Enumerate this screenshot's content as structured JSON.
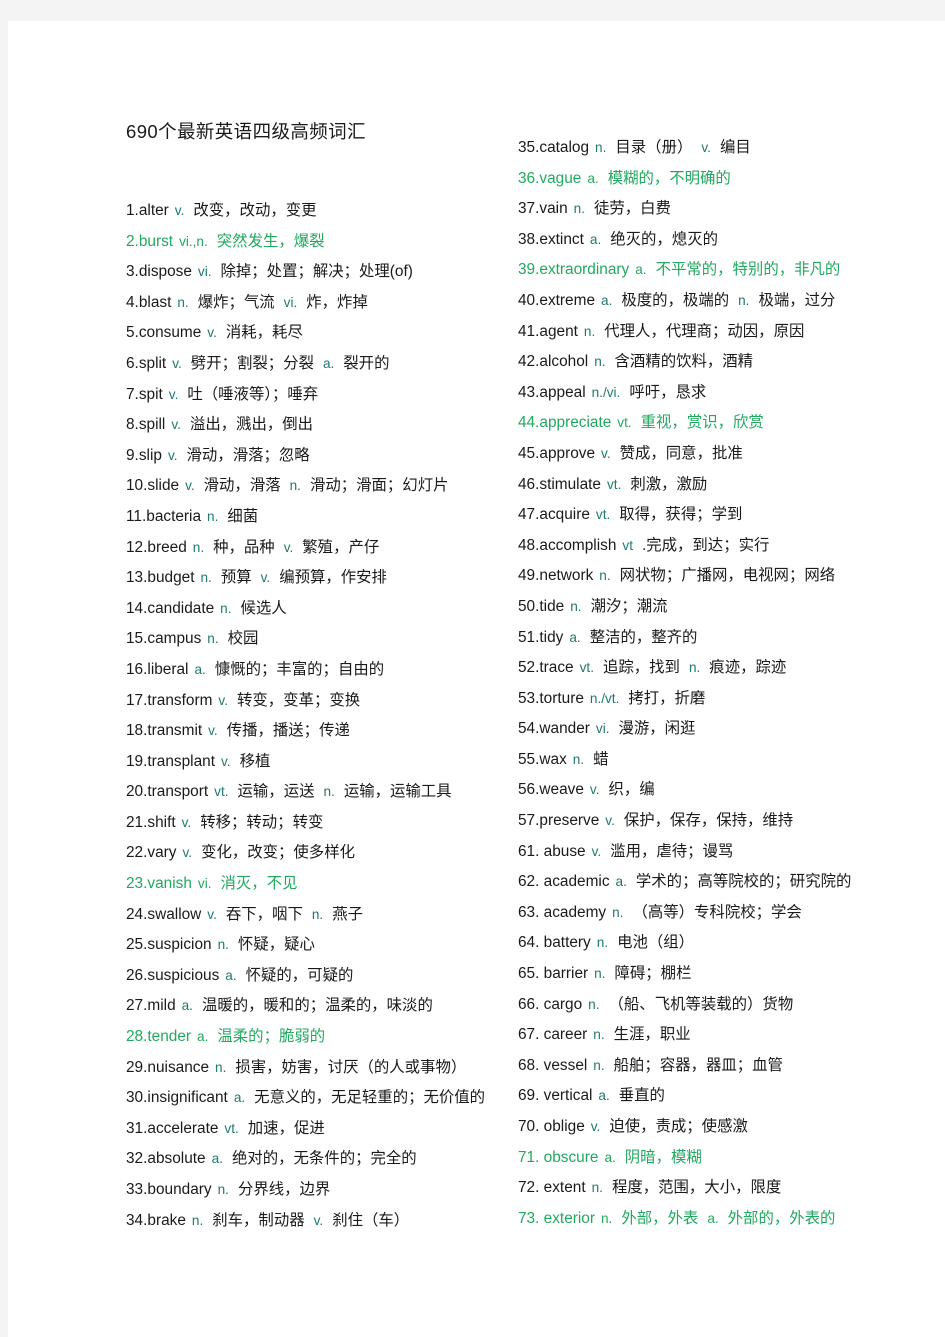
{
  "document": {
    "title": "690个最新英语四级高频词汇",
    "colors": {
      "body_text": "#1a1a1a",
      "highlight_green": "#22a95f",
      "part_of_speech_teal": "#1f7a6e",
      "page_background": "#ffffff",
      "canvas_background": "#f4f4f4"
    }
  },
  "left_column": [
    {
      "num": "1.",
      "word": "alter",
      "pos": "v.",
      "gloss": "改变，改动，变更",
      "green": false
    },
    {
      "num": "2.",
      "word": "burst",
      "pos": "vi.,n.",
      "gloss": "突然发生，爆裂",
      "green": true
    },
    {
      "num": "3.",
      "word": "dispose",
      "pos": "vi.",
      "gloss": "除掉；处置；解决；处理(of)",
      "green": false
    },
    {
      "num": "4.",
      "word": "blast",
      "pos": "n.",
      "gloss": "爆炸；气流",
      "pos2": "vi.",
      "gloss2": "炸，炸掉",
      "green": false
    },
    {
      "num": "5.",
      "word": "consume",
      "pos": "v.",
      "gloss": "消耗，耗尽",
      "green": false
    },
    {
      "num": "6.",
      "word": "split",
      "pos": "v.",
      "gloss": "劈开；割裂；分裂",
      "pos2": "a.",
      "gloss2": "裂开的",
      "green": false
    },
    {
      "num": "7.",
      "word": "spit",
      "pos": "v.",
      "gloss": "吐（唾液等）；唾弃",
      "green": false
    },
    {
      "num": "8.",
      "word": "spill",
      "pos": "v.",
      "gloss": "溢出，溅出，倒出",
      "green": false
    },
    {
      "num": "9.",
      "word": "slip",
      "pos": "v.",
      "gloss": "滑动，滑落；忽略",
      "green": false
    },
    {
      "num": "10.",
      "word": "slide",
      "pos": "v.",
      "gloss": "滑动，滑落",
      "pos2": "n.",
      "gloss2": "滑动；滑面；幻灯片",
      "green": false
    },
    {
      "num": "11.",
      "word": "bacteria",
      "pos": "n.",
      "gloss": "细菌",
      "green": false
    },
    {
      "num": "12.",
      "word": "breed",
      "pos": "n.",
      "gloss": "种，品种",
      "pos2": "v.",
      "gloss2": "繁殖，产仔",
      "green": false
    },
    {
      "num": "13.",
      "word": "budget",
      "pos": "n.",
      "gloss": "预算",
      "pos2": "v.",
      "gloss2": "编预算，作安排",
      "green": false
    },
    {
      "num": "14.",
      "word": "candidate",
      "pos": "n.",
      "gloss": "候选人",
      "green": false
    },
    {
      "num": "15.",
      "word": "campus",
      "pos": "n.",
      "gloss": "校园",
      "green": false
    },
    {
      "num": "16.",
      "word": "liberal",
      "pos": "a.",
      "gloss": "慷慨的；丰富的；自由的",
      "green": false
    },
    {
      "num": "17.",
      "word": "transform",
      "pos": "v.",
      "gloss": "转变，变革；变换",
      "green": false
    },
    {
      "num": "18.",
      "word": "transmit",
      "pos": "v.",
      "gloss": "传播，播送；传递",
      "green": false
    },
    {
      "num": "19.",
      "word": "transplant",
      "pos": "v.",
      "gloss": "移植",
      "green": false
    },
    {
      "num": "20.",
      "word": "transport",
      "pos": "vt.",
      "gloss": "运输，运送",
      "pos2": "n.",
      "gloss2": "运输，运输工具",
      "green": false
    },
    {
      "num": "21.",
      "word": "shift",
      "pos": "v.",
      "gloss": "转移；转动；转变",
      "green": false
    },
    {
      "num": "22.",
      "word": "vary",
      "pos": "v.",
      "gloss": "变化，改变；使多样化",
      "green": false
    },
    {
      "num": "23.",
      "word": "vanish",
      "pos": "vi.",
      "gloss": "消灭，不见",
      "green": true
    },
    {
      "num": "24.",
      "word": "swallow",
      "pos": "v.",
      "gloss": "吞下，咽下",
      "pos2": "n.",
      "gloss2": "燕子",
      "green": false
    },
    {
      "num": "25.",
      "word": "suspicion",
      "pos": "n.",
      "gloss": "怀疑，疑心",
      "green": false
    },
    {
      "num": "26.",
      "word": "suspicious",
      "pos": "a.",
      "gloss": "怀疑的，可疑的",
      "green": false
    },
    {
      "num": "27.",
      "word": "mild",
      "pos": "a.",
      "gloss": "温暖的，暖和的；温柔的，味淡的",
      "green": false
    },
    {
      "num": "28.",
      "word": "tender",
      "pos": "a.",
      "gloss": "温柔的；脆弱的",
      "green": true
    },
    {
      "num": "29.",
      "word": "nuisance",
      "pos": "n.",
      "gloss": "损害，妨害，讨厌（的人或事物）",
      "green": false
    },
    {
      "num": "30.",
      "word": "insignificant",
      "pos": "a.",
      "gloss": "无意义的，无足轻重的；无价值的",
      "green": false
    },
    {
      "num": "31.",
      "word": "accelerate",
      "pos": "vt.",
      "gloss": "加速，促进",
      "green": false
    },
    {
      "num": "32.",
      "word": "absolute",
      "pos": "a.",
      "gloss": "绝对的，无条件的；完全的",
      "green": false
    },
    {
      "num": "33.",
      "word": "boundary",
      "pos": "n.",
      "gloss": "分界线，边界",
      "green": false
    },
    {
      "num": "34.",
      "word": "brake",
      "pos": "n.",
      "gloss": "刹车，制动器",
      "pos2": "v.",
      "gloss2": "刹住（车）",
      "green": false
    }
  ],
  "right_column": [
    {
      "num": "35.",
      "word": "catalog",
      "pos": "n.",
      "gloss": "目录（册）",
      "pos2": "v.",
      "gloss2": "编目",
      "green": false
    },
    {
      "num": "36.",
      "word": "vague",
      "pos": "a.",
      "gloss": "模糊的，不明确的",
      "green": true
    },
    {
      "num": "37.",
      "word": "vain",
      "pos": "n.",
      "gloss": "徒劳，白费",
      "green": false
    },
    {
      "num": "38.",
      "word": "extinct",
      "pos": "a.",
      "gloss": "绝灭的，熄灭的",
      "green": false
    },
    {
      "num": "39.",
      "word": "extraordinary",
      "pos": "a.",
      "gloss": "不平常的，特别的，非凡的",
      "green": true
    },
    {
      "num": "40.",
      "word": "extreme",
      "pos": "a.",
      "gloss": "极度的，极端的",
      "pos2": "n.",
      "gloss2": "极端，过分",
      "green": false
    },
    {
      "num": "41.",
      "word": "agent",
      "pos": "n.",
      "gloss": "代理人，代理商；动因，原因",
      "green": false
    },
    {
      "num": "42.",
      "word": "alcohol",
      "pos": "n.",
      "gloss": "含酒精的饮料，酒精",
      "green": false
    },
    {
      "num": "43.",
      "word": "appeal",
      "pos": "n./vi.",
      "gloss": "呼吁，恳求",
      "green": false
    },
    {
      "num": "44.",
      "word": "appreciate",
      "pos": "vt.",
      "gloss": "重视，赏识，欣赏",
      "green": true
    },
    {
      "num": "45.",
      "word": "approve",
      "pos": "v.",
      "gloss": "赞成，同意，批准",
      "green": false
    },
    {
      "num": "46.",
      "word": "stimulate",
      "pos": "vt.",
      "gloss": "刺激，激励",
      "green": false
    },
    {
      "num": "47.",
      "word": "acquire",
      "pos": "vt.",
      "gloss": "取得，获得；学到",
      "green": false
    },
    {
      "num": "48.",
      "word": "accomplish",
      "pos": "vt",
      "gloss": ".完成，到达；实行",
      "green": false
    },
    {
      "num": "49.",
      "word": "network",
      "pos": "n.",
      "gloss": "网状物；广播网，电视网；网络",
      "green": false
    },
    {
      "num": "50.",
      "word": "tide",
      "pos": "n.",
      "gloss": "潮汐；潮流",
      "green": false
    },
    {
      "num": "51.",
      "word": "tidy",
      "pos": "a.",
      "gloss": "整洁的，整齐的",
      "green": false
    },
    {
      "num": "52.",
      "word": "trace",
      "pos": "vt.",
      "gloss": "追踪，找到",
      "pos2": "n.",
      "gloss2": "痕迹，踪迹",
      "green": false
    },
    {
      "num": "53.",
      "word": "torture",
      "pos": "n./vt.",
      "gloss": "拷打，折磨",
      "green": false
    },
    {
      "num": "54.",
      "word": "wander",
      "pos": "vi.",
      "gloss": "漫游，闲逛",
      "green": false
    },
    {
      "num": "55.",
      "word": "wax",
      "pos": "n.",
      "gloss": "蜡",
      "green": false
    },
    {
      "num": "56.",
      "word": "weave",
      "pos": "v.",
      "gloss": "织，编",
      "green": false
    },
    {
      "num": "57.",
      "word": "preserve",
      "pos": "v.",
      "gloss": "保护，保存，保持，维持",
      "green": false
    },
    {
      "num": "61. ",
      "word": "abuse",
      "pos": "v.",
      "gloss": "滥用，虐待；谩骂",
      "green": false
    },
    {
      "num": "62. ",
      "word": "academic",
      "pos": "a.",
      "gloss": "学术的；高等院校的；研究院的",
      "green": false
    },
    {
      "num": "63. ",
      "word": "academy",
      "pos": "n.",
      "gloss": "（高等）专科院校；学会",
      "green": false
    },
    {
      "num": "64. ",
      "word": "battery",
      "pos": "n.",
      "gloss": "电池（组）",
      "green": false
    },
    {
      "num": "65. ",
      "word": "barrier",
      "pos": "n.",
      "gloss": "障碍；棚栏",
      "green": false
    },
    {
      "num": "66. ",
      "word": "cargo",
      "pos": "n.",
      "gloss": "（船、飞机等装载的）货物",
      "green": false
    },
    {
      "num": "67. ",
      "word": "career",
      "pos": "n.",
      "gloss": "生涯，职业",
      "green": false
    },
    {
      "num": "68. ",
      "word": "vessel",
      "pos": "n.",
      "gloss": "船舶；容器，器皿；血管",
      "green": false
    },
    {
      "num": "69. ",
      "word": "vertical",
      "pos": "a.",
      "gloss": "垂直的",
      "green": false
    },
    {
      "num": "70. ",
      "word": "oblige",
      "pos": "v.",
      "gloss": "迫使，责成；使感激",
      "green": false
    },
    {
      "num": "71. ",
      "word": "obscure",
      "pos": "a.",
      "gloss": "阴暗，模糊",
      "green": true
    },
    {
      "num": "72. ",
      "word": "extent",
      "pos": "n.",
      "gloss": "程度，范围，大小，限度",
      "green": false
    },
    {
      "num": "73. ",
      "word": "exterior",
      "pos": "n.",
      "gloss": "外部，外表",
      "pos2": "a.",
      "gloss2": "外部的，外表的",
      "green": true
    }
  ]
}
